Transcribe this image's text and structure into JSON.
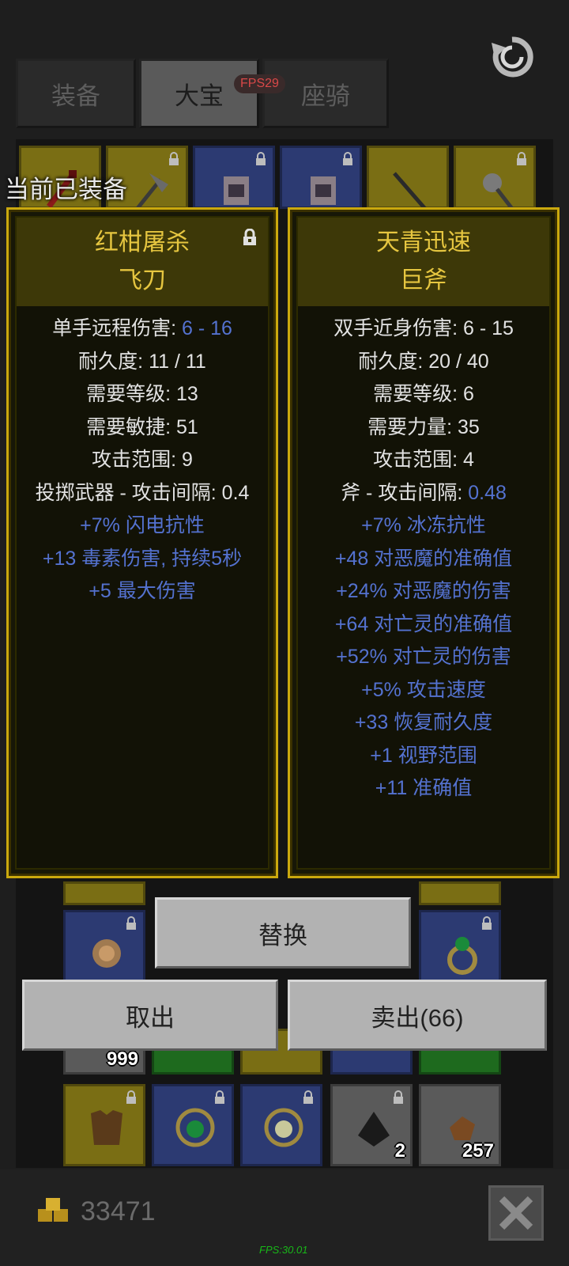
{
  "tabs": [
    {
      "label": "装备",
      "active": false
    },
    {
      "label": "大宝",
      "active": true
    },
    {
      "label": "座骑",
      "active": false
    }
  ],
  "fps_badge": "FPS29",
  "equipped_label": "当前已装备",
  "left_item": {
    "name_line1": "红柑屠杀",
    "name_line2": "飞刀",
    "stats": [
      {
        "label": "单手远程伤害: ",
        "value": "6 - 16",
        "value_blue": true
      },
      {
        "label": "耐久度: 11 / 11"
      },
      {
        "label": "需要等级: 13"
      },
      {
        "label": "需要敏捷: 51"
      },
      {
        "label": "攻击范围: 9"
      },
      {
        "label": "投掷武器 - 攻击间隔: 0.4"
      },
      {
        "label": "+7% 闪电抗性",
        "blue": true
      },
      {
        "label": "+13 毒素伤害, 持续5秒",
        "blue": true
      },
      {
        "label": "+5 最大伤害",
        "blue": true
      }
    ]
  },
  "right_item": {
    "name_line1": "天青迅速",
    "name_line2": "巨斧",
    "stats": [
      {
        "label": "双手近身伤害: 6 - 15"
      },
      {
        "label": "耐久度: 20 / 40"
      },
      {
        "label": "需要等级: 6"
      },
      {
        "label": "需要力量: 35"
      },
      {
        "label": "攻击范围: 4"
      },
      {
        "label": "斧 - 攻击间隔: ",
        "value": "0.48",
        "value_blue": true
      },
      {
        "label": "+7% 冰冻抗性",
        "blue": true
      },
      {
        "label": "+48 对恶魔的准确值",
        "blue": true
      },
      {
        "label": "+24% 对恶魔的伤害",
        "blue": true
      },
      {
        "label": "+64 对亡灵的准确值",
        "blue": true
      },
      {
        "label": "+52% 对亡灵的伤害",
        "blue": true
      },
      {
        "label": "+5% 攻击速度",
        "blue": true
      },
      {
        "label": "+33 恢复耐久度",
        "blue": true
      },
      {
        "label": "+1 视野范围",
        "blue": true
      },
      {
        "label": "+11 准确值",
        "blue": true
      }
    ]
  },
  "buttons": {
    "replace": "替换",
    "take_out": "取出",
    "sell": "卖出(66)"
  },
  "slot_counts": {
    "arrows": "999",
    "coal": "2",
    "ore": "257"
  },
  "gold": "33471",
  "fps_footer": "FPS:30.01",
  "colors": {
    "tooltip_border": "#caa80e",
    "item_name": "#e6c640",
    "magic_stat": "#5472d0",
    "slot_yellow": "#7a6e14",
    "slot_blue": "#2c3a72",
    "slot_green": "#1e6a1e",
    "slot_gray": "#5a5a5a"
  }
}
